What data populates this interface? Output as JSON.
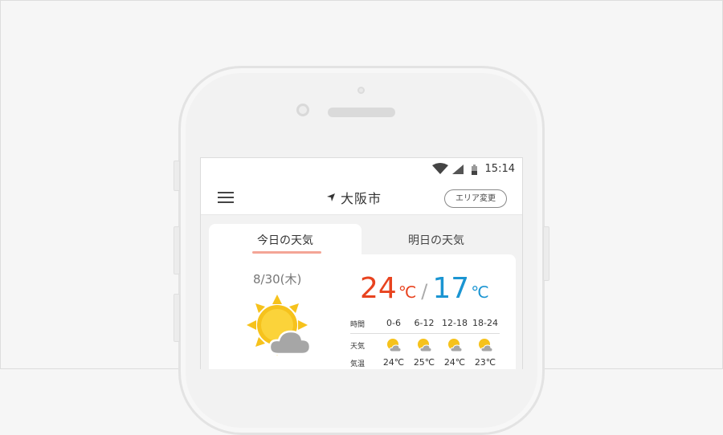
{
  "status_bar": {
    "time": "15:14",
    "icons": [
      "wifi-icon",
      "signal-icon",
      "battery-icon"
    ]
  },
  "header": {
    "menu_icon": "hamburger-menu-icon",
    "location_icon": "location-arrow-icon",
    "location": "大阪市",
    "area_button": "エリア変更"
  },
  "tabs": [
    {
      "label": "今日の天気",
      "active": true
    },
    {
      "label": "明日の天気",
      "active": false
    }
  ],
  "today": {
    "date": "8/30(木)",
    "weather_icon": "sunny-then-cloudy-icon",
    "high": "24",
    "low": "17",
    "unit": "℃",
    "separator": "/",
    "forecast": {
      "row_labels": {
        "time": "時間",
        "weather": "天気",
        "temp": "気温"
      },
      "periods": [
        {
          "time": "0-6",
          "icon": "sun-cloud-icon",
          "temp": "24℃"
        },
        {
          "time": "6-12",
          "icon": "sun-cloud-icon",
          "temp": "25℃"
        },
        {
          "time": "12-18",
          "icon": "sun-cloud-icon",
          "temp": "24℃"
        },
        {
          "time": "18-24",
          "icon": "sun-cloud-icon",
          "temp": "23℃"
        }
      ]
    }
  },
  "colors": {
    "high_temp": "#e8431f",
    "low_temp": "#1b95d2",
    "tab_underline": "#f4a596",
    "sun": "#f6c21c"
  }
}
